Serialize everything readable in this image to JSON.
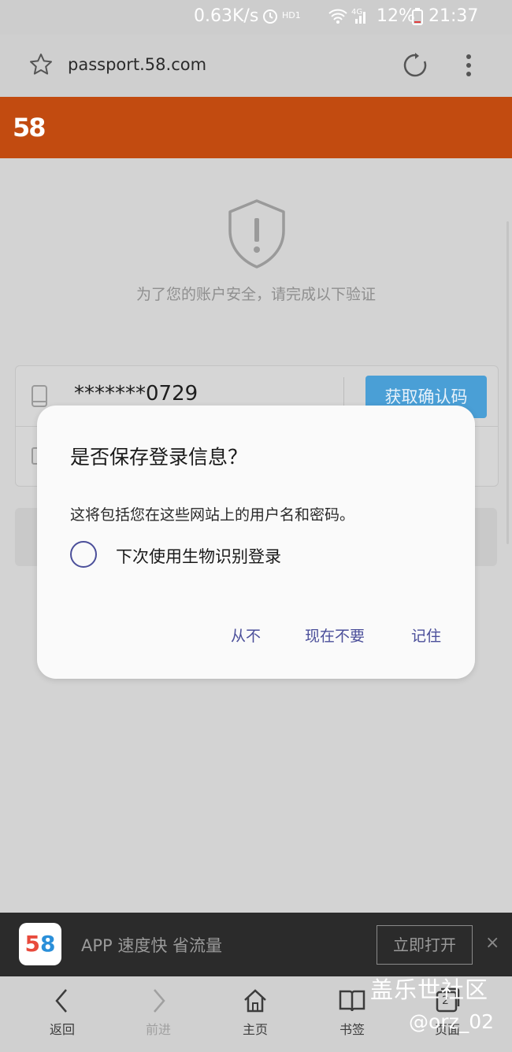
{
  "status_bar": {
    "network_speed": "0.63K/s",
    "hd_label": "HD1",
    "signal_label": "4G",
    "battery": "12%",
    "time": "21:37"
  },
  "browser": {
    "url": "passport.58.com"
  },
  "site": {
    "logo": "58"
  },
  "page": {
    "verify_message": "为了您的账户安全，请完成以下验证",
    "phone_value": "*******0729",
    "get_code_label": "获取确认码"
  },
  "dialog": {
    "title": "是否保存登录信息？",
    "message": "这将包括您在这些网站上的用户名和密码。",
    "biometric_label": "下次使用生物识别登录",
    "buttons": {
      "never": "从不",
      "not_now": "现在不要",
      "remember": "记住"
    }
  },
  "app_banner": {
    "icon_digit_1": "5",
    "icon_digit_2": "8",
    "text": "APP 速度快 省流量",
    "open_label": "立即打开",
    "close": "×"
  },
  "bottom_nav": {
    "back": "返回",
    "forward": "前进",
    "home": "主页",
    "bookmarks": "书签",
    "tabs": "页面",
    "tab_count": "2"
  },
  "watermark": {
    "line1": "盖乐世社区",
    "line2": "@orz_02"
  },
  "colors": {
    "header_orange": "#c24b10",
    "button_blue": "#4a9fd6",
    "dialog_accent": "#4b4f9a"
  }
}
